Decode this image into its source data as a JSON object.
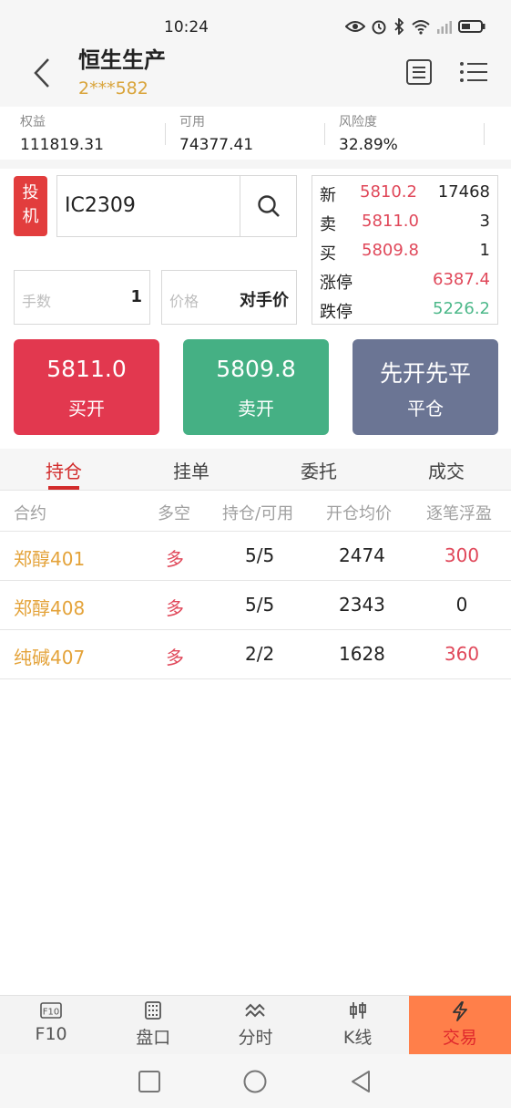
{
  "status": {
    "time": "10:24"
  },
  "header": {
    "account_name": "恒生生产",
    "account_id": "2***582"
  },
  "stats": [
    {
      "label": "权益",
      "value": "111819.31"
    },
    {
      "label": "可用",
      "value": "74377.41"
    },
    {
      "label": "风险度",
      "value": "32.89%"
    }
  ],
  "order": {
    "tag_line1": "投",
    "tag_line2": "机",
    "contract_code": "IC2309",
    "qty_placeholder": "手数",
    "qty_value": "1",
    "price_placeholder": "价格",
    "price_value": "对手价"
  },
  "quote": {
    "last_label": "新",
    "last_price": "5810.2",
    "last_vol": "17468",
    "ask_label": "卖",
    "ask_price": "5811.0",
    "ask_vol": "3",
    "bid_label": "买",
    "bid_price": "5809.8",
    "bid_vol": "1",
    "up_label": "涨停",
    "up_limit": "6387.4",
    "down_label": "跌停",
    "down_limit": "5226.2"
  },
  "actions": {
    "buy_price": "5811.0",
    "buy_label": "买开",
    "sell_price": "5809.8",
    "sell_label": "卖开",
    "close_price": "先开先平",
    "close_label": "平仓"
  },
  "tabs": [
    "持仓",
    "挂单",
    "委托",
    "成交"
  ],
  "table": {
    "headers": [
      "合约",
      "多空",
      "持仓/可用",
      "开仓均价",
      "逐笔浮盈"
    ],
    "rows": [
      {
        "name": "郑醇401",
        "dir": "多",
        "pos": "5/5",
        "avg": "2474",
        "pnl": "300"
      },
      {
        "name": "郑醇408",
        "dir": "多",
        "pos": "5/5",
        "avg": "2343",
        "pnl": "0"
      },
      {
        "name": "纯碱407",
        "dir": "多",
        "pos": "2/2",
        "avg": "1628",
        "pnl": "360"
      }
    ]
  },
  "bottom_nav": [
    "F10",
    "盘口",
    "分时",
    "K线",
    "交易"
  ],
  "colors": {
    "accent": "#ff7f4a",
    "up": "#e0485a",
    "down": "#4db88a",
    "gold": "#e4a33a"
  }
}
